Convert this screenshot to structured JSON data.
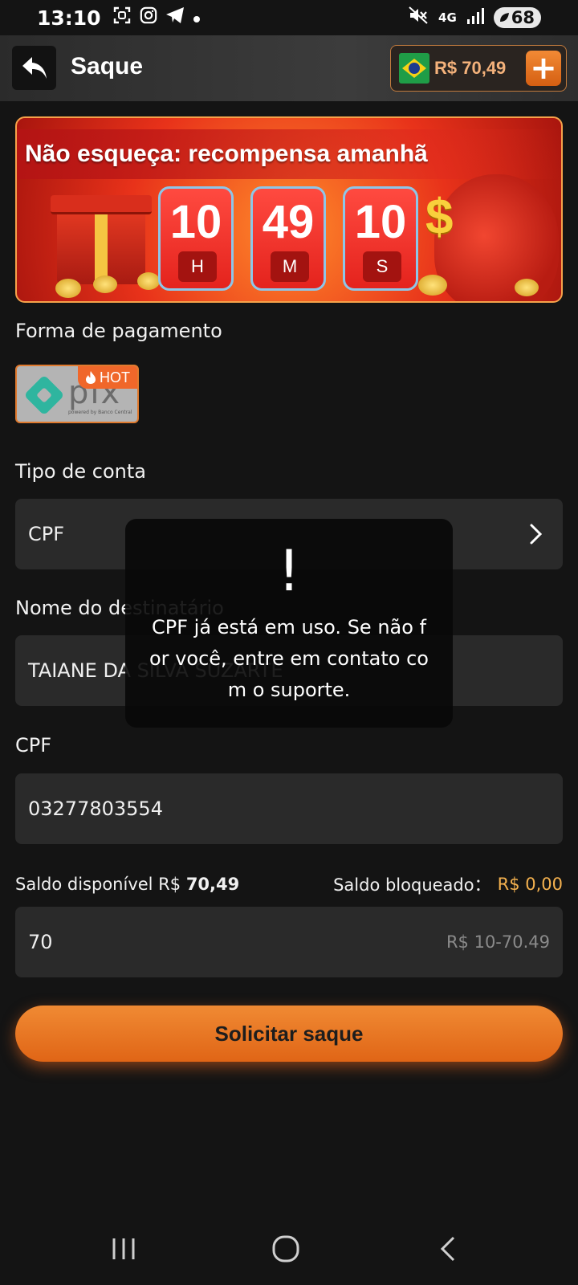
{
  "status_bar": {
    "time": "13:10",
    "network": "4G",
    "battery": "68",
    "icons": [
      "screenshot-icon",
      "instagram-icon",
      "telegram-icon",
      "dot-icon",
      "mute-icon",
      "signal-icon",
      "battery-icon"
    ]
  },
  "header": {
    "title": "Saque",
    "balance": "R$ 70,49",
    "add_label": "+"
  },
  "banner": {
    "title": "Não esqueça: recompensa amanhã",
    "hours": "10",
    "hours_unit": "H",
    "minutes": "49",
    "minutes_unit": "M",
    "seconds": "10",
    "seconds_unit": "S",
    "currency_symbol": "$"
  },
  "payment": {
    "label": "Forma de pagamento",
    "method_name": "pix",
    "method_sub": "powered by Banco Central",
    "badge": "HOT"
  },
  "account_type": {
    "label": "Tipo de conta",
    "value": "CPF"
  },
  "recipient": {
    "label": "Nome do destinatário",
    "value": "TAIANE DA SILVA SUZARTE"
  },
  "cpf": {
    "label": "CPF",
    "value": "03277803554"
  },
  "balances": {
    "available_label": "Saldo disponível R$ ",
    "available_value": "70,49",
    "locked_label": "Saldo bloqueado：",
    "locked_value": "R$ 0,00"
  },
  "amount": {
    "value": "70",
    "range_hint": "R$ 10-70.49"
  },
  "submit_label": "Solicitar saque",
  "toast": {
    "icon": "!",
    "message": "CPF já está em uso. Se não for você, entre em contato com o suporte."
  },
  "colors": {
    "accent": "#e87422",
    "background": "#141414",
    "field": "#2a2a2a",
    "locked_amount": "#f4b14f"
  }
}
